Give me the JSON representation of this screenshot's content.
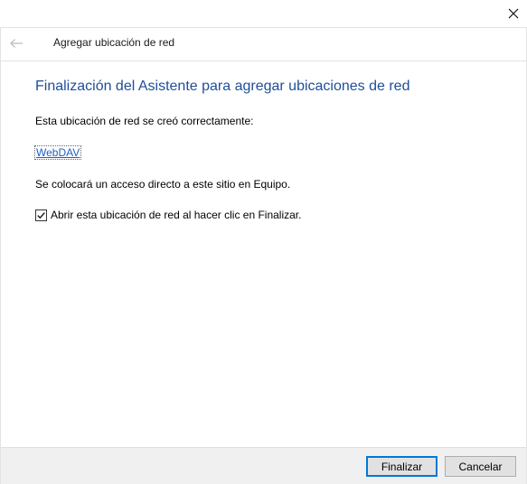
{
  "window": {
    "close_icon": "close-icon"
  },
  "nav": {
    "back_icon": "back-arrow-icon",
    "title": "Agregar ubicación de red"
  },
  "content": {
    "heading": "Finalización del Asistente para agregar ubicaciones de red",
    "created_text": "Esta ubicación de red se creó correctamente:",
    "location_link": "WebDAV",
    "shortcut_text": "Se colocará un acceso directo a este sitio en Equipo.",
    "open_checkbox_label": "Abrir esta ubicación de red al hacer clic en Finalizar.",
    "open_checkbox_checked": true
  },
  "footer": {
    "finish_label": "Finalizar",
    "cancel_label": "Cancelar"
  },
  "colors": {
    "heading": "#1f4e99",
    "link": "#1f5ec8",
    "primary_border": "#0078d7",
    "footer_bg": "#f0f0f0"
  }
}
